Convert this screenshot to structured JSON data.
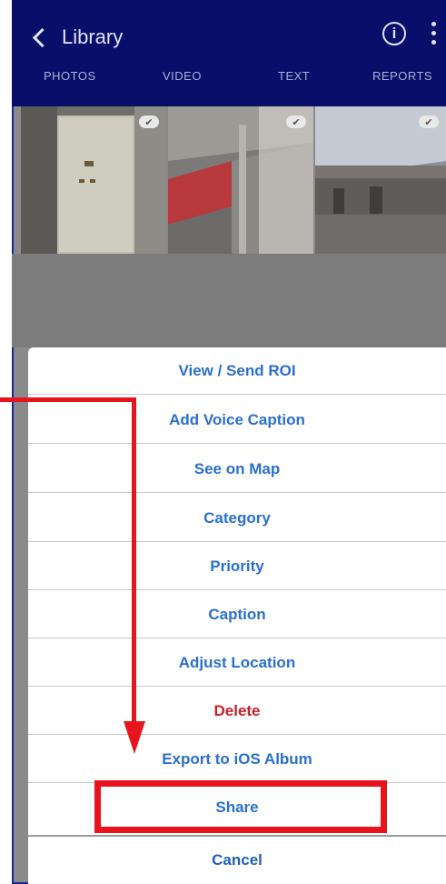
{
  "header": {
    "back_label": "Library",
    "info_icon": "info-icon",
    "more_icon": "more-vertical-icon",
    "info_glyph": "i"
  },
  "tabs": [
    "PHOTOS",
    "VIDEO",
    "TEXT",
    "REPORTS"
  ],
  "photos": {
    "selected_glyph": "✔"
  },
  "action_sheet": {
    "items": [
      "View / Send ROI",
      "Add Voice Caption",
      "See on Map",
      "Category",
      "Priority",
      "Caption",
      "Adjust Location",
      "Delete",
      "Export to iOS Album",
      "Share"
    ],
    "cancel_label": "Cancel"
  },
  "colors": {
    "header_bg": "#0a0e6b",
    "action_text": "#2a6fcf",
    "delete_text": "#c8202a",
    "annotation": "#e8141d"
  }
}
